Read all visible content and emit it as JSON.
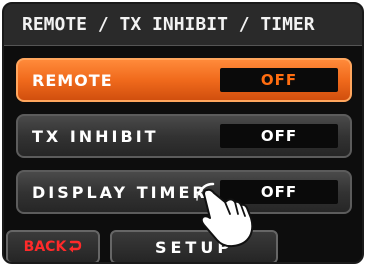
{
  "screen": {
    "title": "REMOTE / TX INHIBIT / TIMER"
  },
  "menu": {
    "items": [
      {
        "label": "REMOTE",
        "value": "OFF",
        "selected": true
      },
      {
        "label": "TX INHIBIT",
        "value": "OFF",
        "selected": false
      },
      {
        "label": "DISPLAY TIMER",
        "value": "OFF",
        "selected": false
      }
    ]
  },
  "footer": {
    "back_label": "BACK",
    "setup_label": "SETUP"
  },
  "icons": {
    "back": "return-arrow-icon",
    "pointer": "hand-pointer-icon"
  },
  "colors": {
    "accent": "#f06a1c",
    "selected_value": "#ff6d10",
    "back_text": "#ff2a2a",
    "background": "#0d0d0d"
  }
}
